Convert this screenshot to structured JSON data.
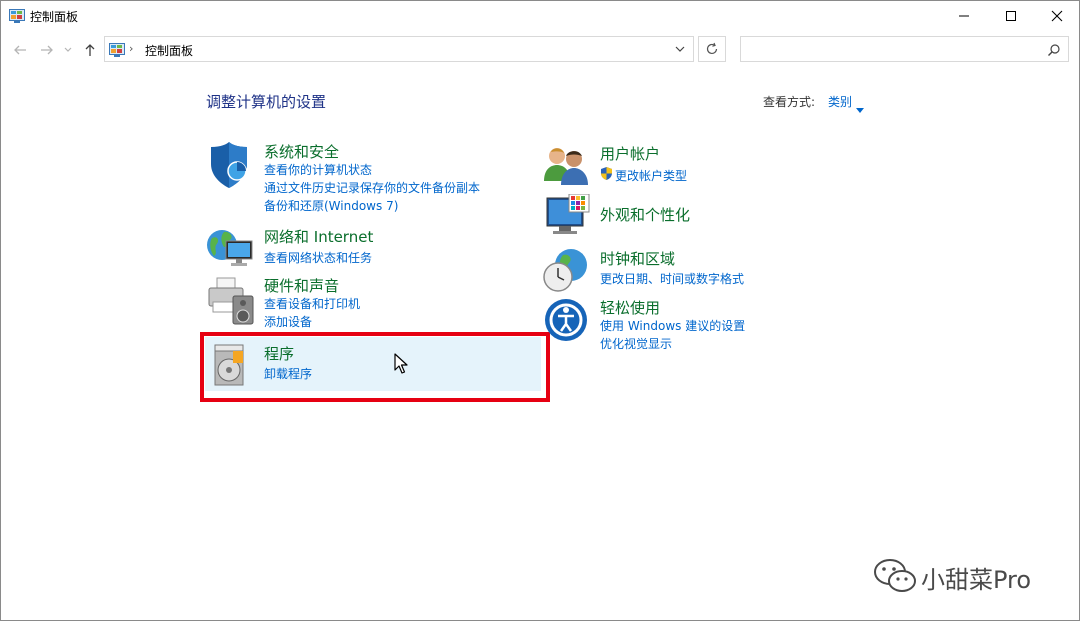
{
  "window": {
    "title": "控制面板",
    "controls": [
      "minimize-icon",
      "maximize-icon",
      "close-icon"
    ]
  },
  "nav": {
    "breadcrumb": "控制面板",
    "search_placeholder": ""
  },
  "main": {
    "heading": "调整计算机的设置",
    "view_by_label": "查看方式:",
    "view_by_value": "类别"
  },
  "categories": [
    {
      "title": "系统和安全",
      "icon": "shield-icon",
      "links": [
        "查看你的计算机状态",
        "通过文件历史记录保存你的文件备份副本",
        "备份和还原(Windows 7)"
      ]
    },
    {
      "title": "网络和 Internet",
      "icon": "network-globe-icon",
      "links": [
        "查看网络状态和任务"
      ]
    },
    {
      "title": "硬件和声音",
      "icon": "printer-speaker-icon",
      "links": [
        "查看设备和打印机",
        "添加设备"
      ]
    },
    {
      "title": "程序",
      "icon": "programs-disc-icon",
      "links": [
        "卸载程序"
      ]
    },
    {
      "title": "用户帐户",
      "icon": "users-icon",
      "links": [
        "更改帐户类型"
      ]
    },
    {
      "title": "外观和个性化",
      "icon": "monitor-palette-icon",
      "links": []
    },
    {
      "title": "时钟和区域",
      "icon": "clock-globe-icon",
      "links": [
        "更改日期、时间或数字格式"
      ]
    },
    {
      "title": "轻松使用",
      "icon": "ease-of-access-icon",
      "links": [
        "使用 Windows 建议的设置",
        "优化视觉显示"
      ]
    }
  ],
  "colors": {
    "category_title": "#0a6e2c",
    "link": "#0066cc",
    "heading": "#1e3287",
    "highlight_border": "#e60012",
    "hover_bg": "#e5f3fb"
  },
  "watermark": {
    "text": "小甜菜Pro",
    "icon": "wechat-icon"
  }
}
